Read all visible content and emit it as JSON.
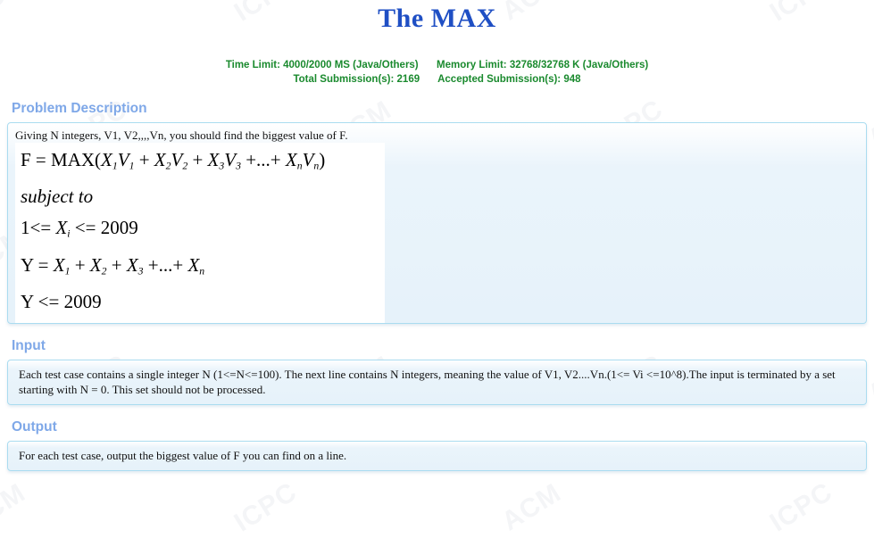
{
  "header": {
    "title": "The MAX",
    "time_limit": "Time Limit: 4000/2000 MS (Java/Others)",
    "memory_limit": "Memory Limit: 32768/32768 K (Java/Others)",
    "total_submissions": "Total Submission(s): 2169",
    "accepted_submissions": "Accepted Submission(s): 948"
  },
  "colors": {
    "title": "#1f4fc4",
    "stats": "#1a8a2e",
    "section_heading": "#7fa8e8",
    "panel_border": "#aadcf0",
    "panel_background": "#e6f2fa"
  },
  "sections": {
    "description": {
      "heading": "Problem Description",
      "intro": "Giving N integers, V1, V2,,,,Vn, you should find the biggest value of F.",
      "formula": {
        "line1_lhs": "F = MAX(",
        "line1_terms": [
          {
            "x": "X",
            "xsub": "1",
            "v": "V",
            "vsub": "1"
          },
          {
            "x": "X",
            "xsub": "2",
            "v": "V",
            "vsub": "2"
          },
          {
            "x": "X",
            "xsub": "3",
            "v": "V",
            "vsub": "3"
          },
          {
            "x": "X",
            "xsub": "n",
            "v": "V",
            "vsub": "n"
          }
        ],
        "line2": "subject to",
        "line3_prefix": "1<= ",
        "line3_var": "X",
        "line3_sub": "i",
        "line3_suffix": " <= 2009",
        "line4_lhs": "Y = ",
        "line4_terms": [
          {
            "x": "X",
            "sub": "1"
          },
          {
            "x": "X",
            "sub": "2"
          },
          {
            "x": "X",
            "sub": "3"
          },
          {
            "x": "X",
            "sub": "n"
          }
        ],
        "line5": "Y <= 2009",
        "plus": "+",
        "ellipsis": "...",
        "close_paren": ")"
      }
    },
    "input": {
      "heading": "Input",
      "text": "Each test case contains a single integer N (1<=N<=100). The next line contains N integers, meaning the value of V1, V2....Vn.(1<= Vi <=10^8).The input is terminated by a set starting with N = 0. This set should not be processed."
    },
    "output": {
      "heading": "Output",
      "text": "For each test case, output the biggest value of F you can find on a line."
    }
  },
  "watermark": {
    "labels": [
      "ACM",
      "ICPC"
    ]
  }
}
